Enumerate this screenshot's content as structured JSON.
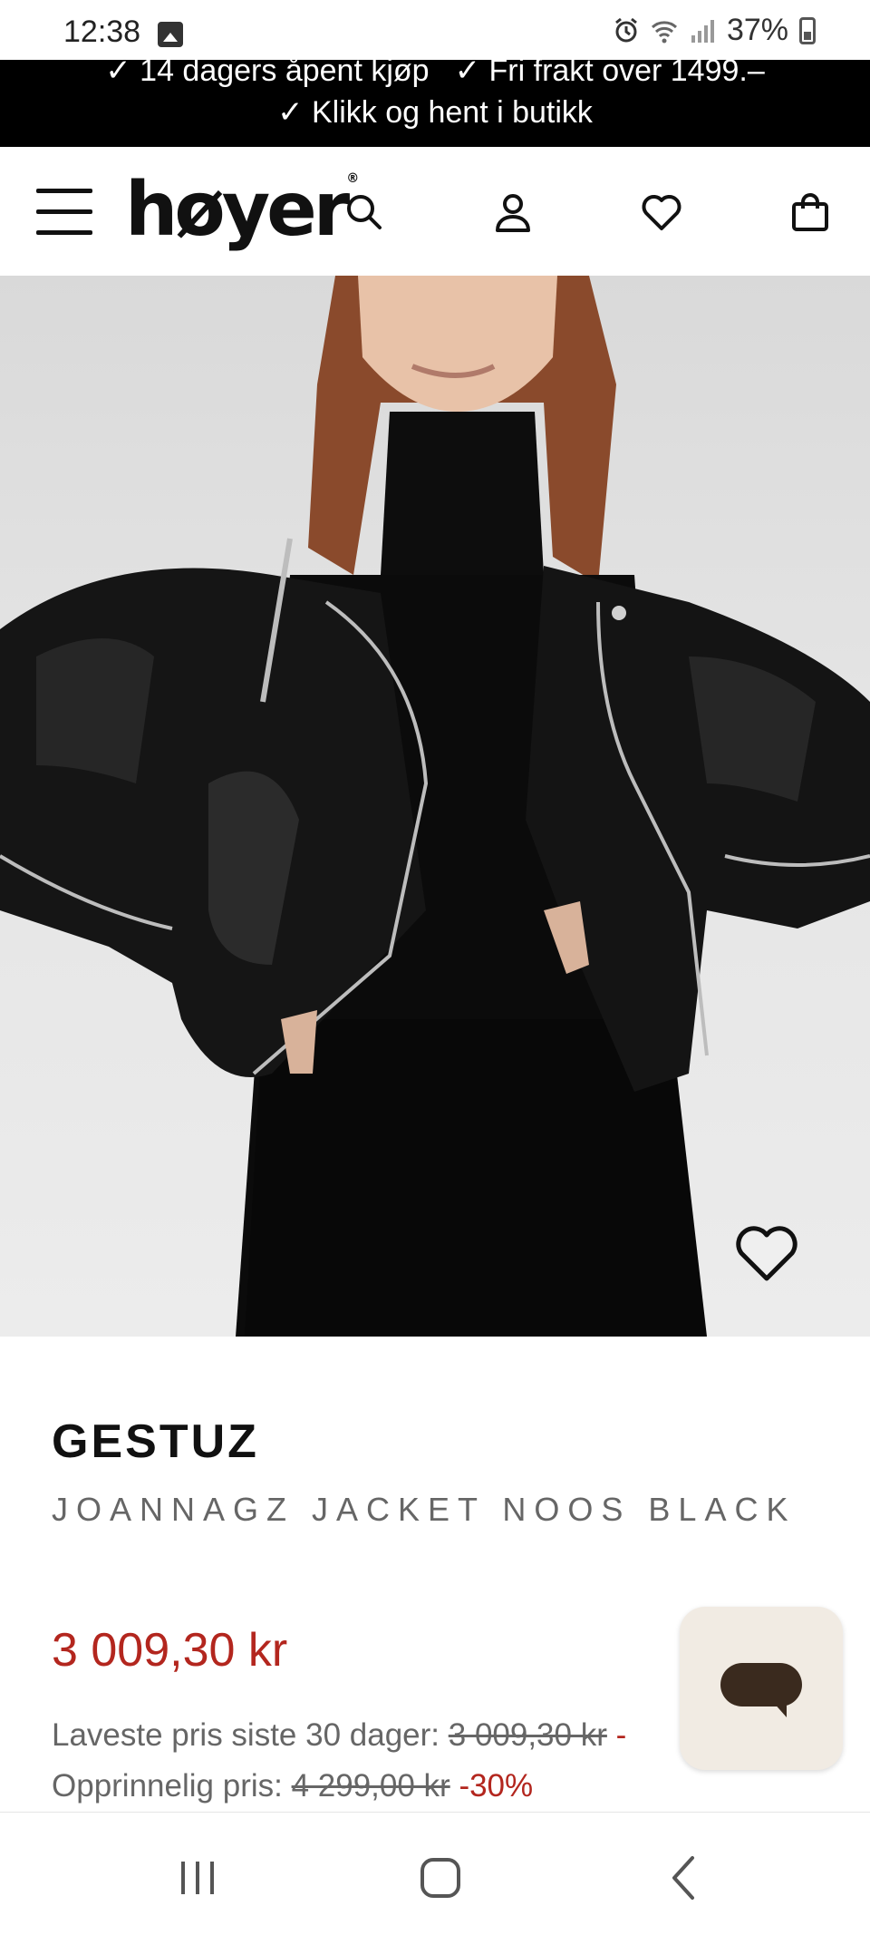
{
  "status_bar": {
    "time": "12:38",
    "battery": "37%"
  },
  "promo": {
    "items": [
      "✓ 14 dagers åpent kjøp",
      "✓ Fri frakt over 1499.–",
      "✓ Klikk og hent i butikk"
    ]
  },
  "header": {
    "logo": "høyer",
    "icons": [
      "menu-icon",
      "search-icon",
      "user-icon",
      "heart-icon",
      "bag-icon"
    ]
  },
  "product": {
    "brand": "GESTUZ",
    "name": "JOANNAGZ JACKET NOOS BLACK",
    "price": "3 009,30 kr",
    "lowest_price_label": "Laveste pris siste 30 dager:",
    "lowest_price_value": "3 009,30 kr",
    "lowest_price_suffix": "-",
    "original_price_label": "Opprinnelig pris:",
    "original_price_value": "4 299,00 kr",
    "discount": "-30%"
  },
  "colors": {
    "accent_red": "#b3261e",
    "promo_bg": "#000000",
    "chat_bg": "#f1ebe3"
  }
}
